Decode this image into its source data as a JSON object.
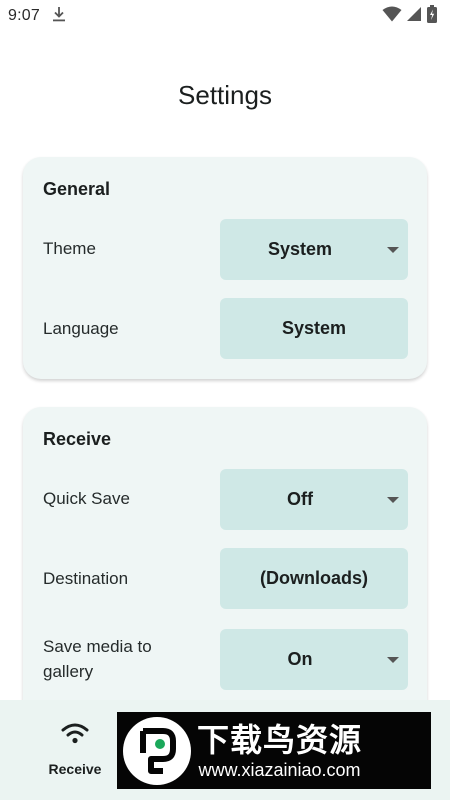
{
  "status_bar": {
    "time": "9:07",
    "icons": [
      "download-icon",
      "wifi-icon",
      "signal-icon",
      "battery-icon"
    ]
  },
  "page": {
    "title": "Settings"
  },
  "sections": {
    "general": {
      "title": "General",
      "theme": {
        "label": "Theme",
        "value": "System"
      },
      "language": {
        "label": "Language",
        "value": "System"
      }
    },
    "receive": {
      "title": "Receive",
      "quick_save": {
        "label": "Quick Save",
        "value": "Off"
      },
      "destination": {
        "label": "Destination",
        "value": "(Downloads)"
      },
      "save_media": {
        "label": "Save media to gallery",
        "value": "On"
      }
    }
  },
  "bottom_nav": {
    "receive": {
      "label": "Receive",
      "icon": "wifi-icon"
    }
  },
  "watermark": {
    "title": "下载鸟资源",
    "url": "www.xiazainiao.com"
  },
  "colors": {
    "card_bg": "#eff6f5",
    "select_bg": "#cfe8e6",
    "nav_bg": "#ebf4f2",
    "text": "#1b1f1f"
  }
}
